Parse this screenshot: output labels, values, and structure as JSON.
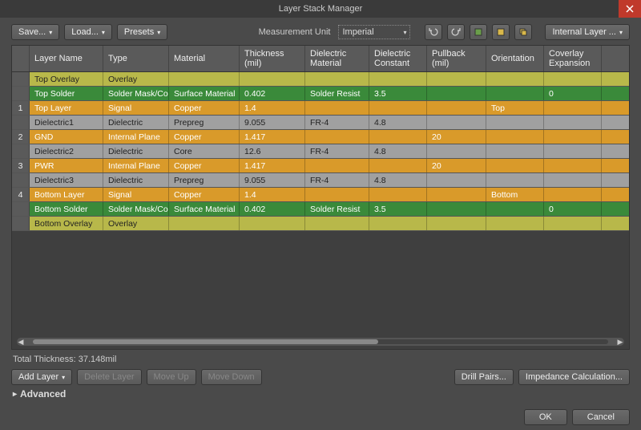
{
  "window": {
    "title": "Layer Stack Manager"
  },
  "toolbar": {
    "save": "Save...",
    "load": "Load...",
    "presets": "Presets",
    "measurement_label": "Measurement Unit",
    "measurement_value": "Imperial",
    "layer_dropdown": "Internal Layer ..."
  },
  "headers": {
    "num": "#",
    "name": "Layer Name",
    "type": "Type",
    "material": "Material",
    "thickness": "Thickness (mil)",
    "dmat": "Dielectric Material",
    "dk": "Dielectric Constant",
    "pullback": "Pullback (mil)",
    "orientation": "Orientation",
    "coverlay": "Coverlay Expansion"
  },
  "rows": [
    {
      "num": "",
      "name": "Top Overlay",
      "type": "Overlay",
      "material": "",
      "thickness": "",
      "dmat": "",
      "dk": "",
      "pullback": "",
      "orientation": "",
      "coverlay": "",
      "style": "row-overlay"
    },
    {
      "num": "",
      "name": "Top Solder",
      "type": "Solder Mask/Co...",
      "material": "Surface Material",
      "thickness": "0.402",
      "dmat": "Solder Resist",
      "dk": "3.5",
      "pullback": "",
      "orientation": "",
      "coverlay": "0",
      "style": "row-solder"
    },
    {
      "num": "1",
      "name": "Top Layer",
      "type": "Signal",
      "material": "Copper",
      "thickness": "1.4",
      "dmat": "",
      "dk": "",
      "pullback": "",
      "orientation": "Top",
      "coverlay": "",
      "style": "row-signal"
    },
    {
      "num": "",
      "name": "Dielectric1",
      "type": "Dielectric",
      "material": "Prepreg",
      "thickness": "9.055",
      "dmat": "FR-4",
      "dk": "4.8",
      "pullback": "",
      "orientation": "",
      "coverlay": "",
      "style": "row-diel"
    },
    {
      "num": "2",
      "name": "GND",
      "type": "Internal Plane",
      "material": "Copper",
      "thickness": "1.417",
      "dmat": "",
      "dk": "",
      "pullback": "20",
      "orientation": "",
      "coverlay": "",
      "style": "row-plane"
    },
    {
      "num": "",
      "name": "Dielectric2",
      "type": "Dielectric",
      "material": "Core",
      "thickness": "12.6",
      "dmat": "FR-4",
      "dk": "4.8",
      "pullback": "",
      "orientation": "",
      "coverlay": "",
      "style": "row-diel"
    },
    {
      "num": "3",
      "name": "PWR",
      "type": "Internal Plane",
      "material": "Copper",
      "thickness": "1.417",
      "dmat": "",
      "dk": "",
      "pullback": "20",
      "orientation": "",
      "coverlay": "",
      "style": "row-plane"
    },
    {
      "num": "",
      "name": "Dielectric3",
      "type": "Dielectric",
      "material": "Prepreg",
      "thickness": "9.055",
      "dmat": "FR-4",
      "dk": "4.8",
      "pullback": "",
      "orientation": "",
      "coverlay": "",
      "style": "row-diel"
    },
    {
      "num": "4",
      "name": "Bottom Layer",
      "type": "Signal",
      "material": "Copper",
      "thickness": "1.4",
      "dmat": "",
      "dk": "",
      "pullback": "",
      "orientation": "Bottom",
      "coverlay": "",
      "style": "row-signal"
    },
    {
      "num": "",
      "name": "Bottom Solder",
      "type": "Solder Mask/Co...",
      "material": "Surface Material",
      "thickness": "0.402",
      "dmat": "Solder Resist",
      "dk": "3.5",
      "pullback": "",
      "orientation": "",
      "coverlay": "0",
      "style": "row-solder"
    },
    {
      "num": "",
      "name": "Bottom Overlay",
      "type": "Overlay",
      "material": "",
      "thickness": "",
      "dmat": "",
      "dk": "",
      "pullback": "",
      "orientation": "",
      "coverlay": "",
      "style": "row-overlay"
    }
  ],
  "footer": {
    "total_thickness": "Total Thickness: 37.148mil",
    "add_layer": "Add Layer",
    "delete_layer": "Delete Layer",
    "move_up": "Move Up",
    "move_down": "Move Down",
    "drill_pairs": "Drill Pairs...",
    "impedance": "Impedance Calculation...",
    "advanced": "Advanced",
    "ok": "OK",
    "cancel": "Cancel"
  }
}
